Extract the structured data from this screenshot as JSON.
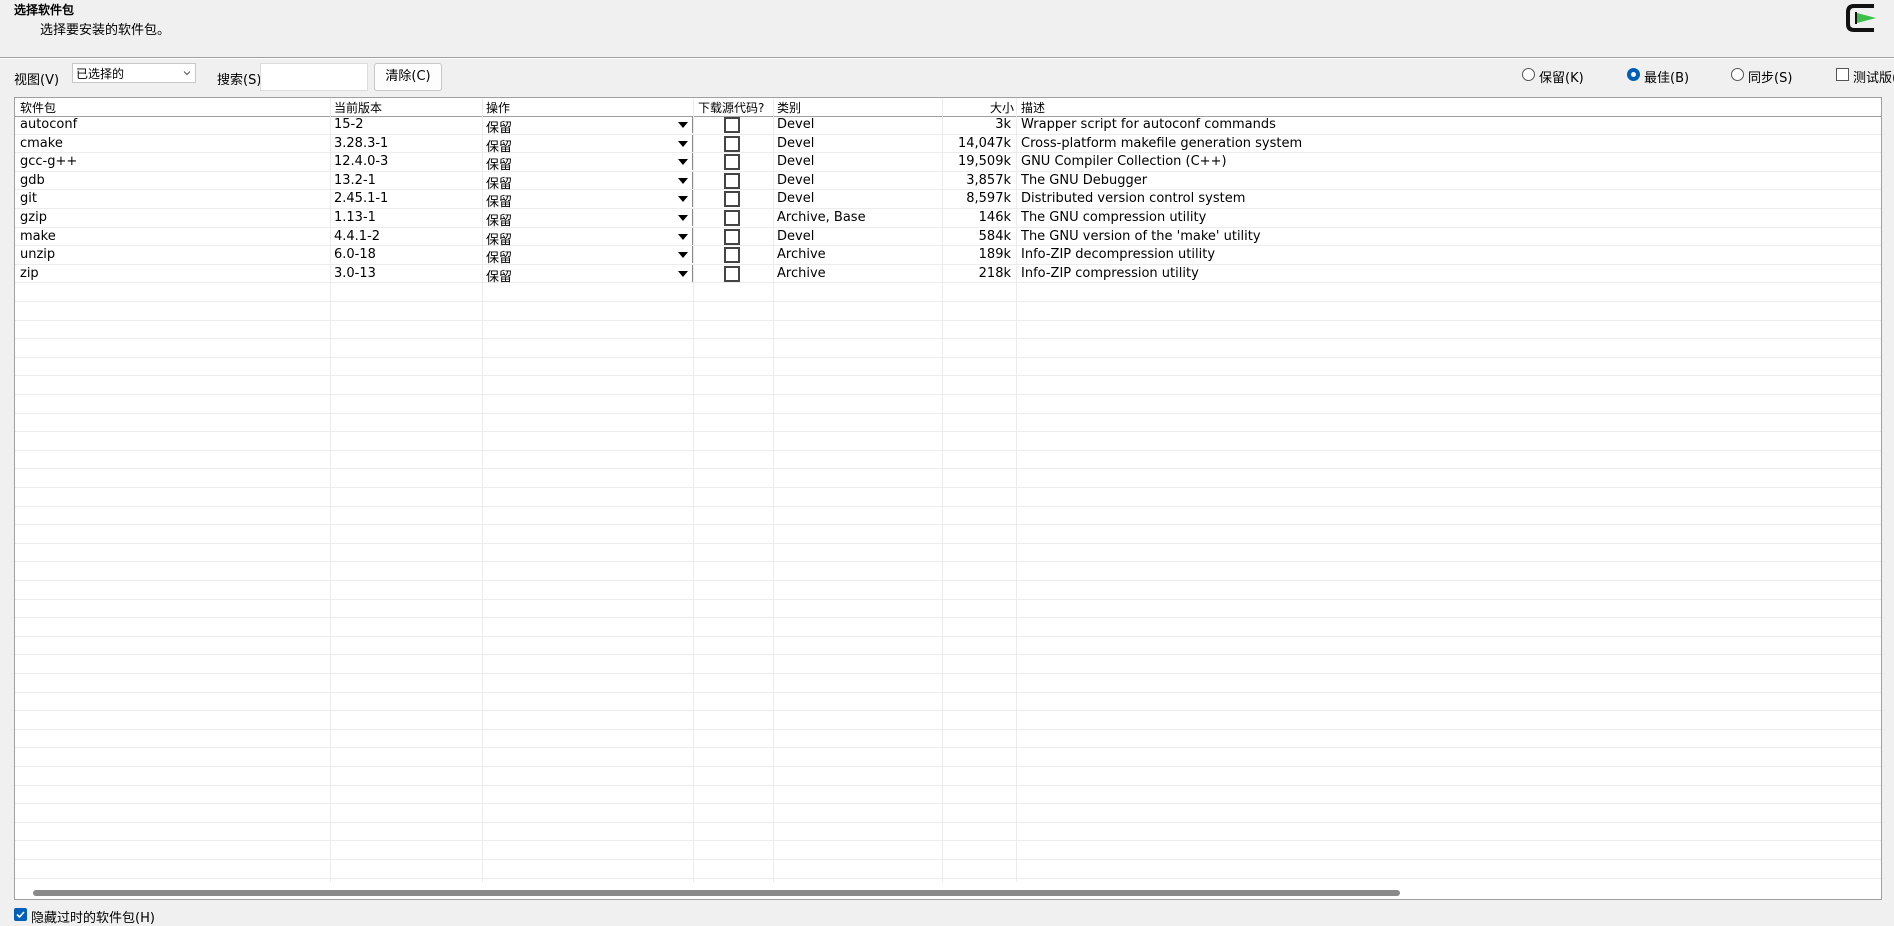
{
  "header": {
    "title": "选择软件包",
    "subtitle": "选择要安装的软件包。"
  },
  "toolbar": {
    "view_label": "视图(V)",
    "view_value": "已选择的",
    "search_label": "搜索(S)",
    "search_value": "",
    "clear_label": "清除(C)",
    "radios": [
      {
        "label": "保留(K)",
        "checked": false
      },
      {
        "label": "最佳(B)",
        "checked": true
      },
      {
        "label": "同步(S)",
        "checked": false
      }
    ],
    "test_label": "测试版("
  },
  "table": {
    "columns": [
      "软件包",
      "当前版本",
      "操作",
      "下载源代码?",
      "类别",
      "大小",
      "描述"
    ],
    "rows": [
      {
        "pkg": "autoconf",
        "ver": "15-2",
        "action": "保留",
        "src": false,
        "cat": "Devel",
        "size": "3k",
        "desc": "Wrapper script for autoconf commands"
      },
      {
        "pkg": "cmake",
        "ver": "3.28.3-1",
        "action": "保留",
        "src": false,
        "cat": "Devel",
        "size": "14,047k",
        "desc": "Cross-platform makefile generation system"
      },
      {
        "pkg": "gcc-g++",
        "ver": "12.4.0-3",
        "action": "保留",
        "src": false,
        "cat": "Devel",
        "size": "19,509k",
        "desc": "GNU Compiler Collection (C++)"
      },
      {
        "pkg": "gdb",
        "ver": "13.2-1",
        "action": "保留",
        "src": false,
        "cat": "Devel",
        "size": "3,857k",
        "desc": "The GNU Debugger"
      },
      {
        "pkg": "git",
        "ver": "2.45.1-1",
        "action": "保留",
        "src": false,
        "cat": "Devel",
        "size": "8,597k",
        "desc": "Distributed version control system"
      },
      {
        "pkg": "gzip",
        "ver": "1.13-1",
        "action": "保留",
        "src": false,
        "cat": "Archive, Base",
        "size": "146k",
        "desc": "The GNU compression utility"
      },
      {
        "pkg": "make",
        "ver": "4.4.1-2",
        "action": "保留",
        "src": false,
        "cat": "Devel",
        "size": "584k",
        "desc": "The GNU version of the 'make' utility"
      },
      {
        "pkg": "unzip",
        "ver": "6.0-18",
        "action": "保留",
        "src": false,
        "cat": "Archive",
        "size": "189k",
        "desc": "Info-ZIP decompression utility"
      },
      {
        "pkg": "zip",
        "ver": "3.0-13",
        "action": "保留",
        "src": false,
        "cat": "Archive",
        "size": "218k",
        "desc": "Info-ZIP compression utility"
      }
    ]
  },
  "footer": {
    "hide_obsolete_label": "隐藏过时的软件包(H)",
    "hide_obsolete_checked": true
  },
  "colors": {
    "accent": "#005fb8",
    "logo_green": "#3bbf4a"
  }
}
